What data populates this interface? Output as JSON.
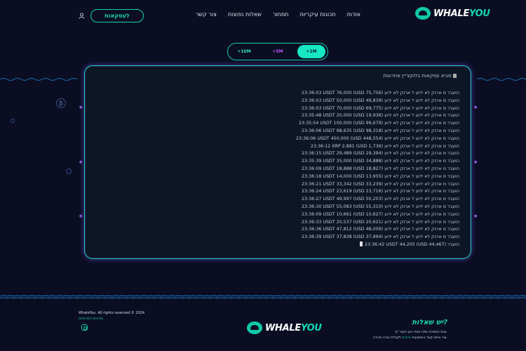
{
  "brand": {
    "name_part1": "WHALE",
    "name_part2": "YOU"
  },
  "nav": {
    "items": [
      "אודות",
      "תכונות עיקריות",
      "תמחור",
      "שאלות נפוצות",
      "צור קשר"
    ],
    "cta_label": "לעסקאות"
  },
  "filters": {
    "options": [
      "+10M",
      "+5M",
      "+1M"
    ],
    "selected": "+1M"
  },
  "feed": {
    "title": "מביא עסקאות בלוקצ'יין אחרונות",
    "rows": [
      "23:36:03 USDT 76,000 (USD 75,756) הועבר מ ארנק לא ידוע ל ארנק לא ידוע",
      "23:36:03 USDT 50,000 (USD 49,839) הועבר מ ארנק לא ידוע ל ארנק לא ידוע",
      "23:36:03 USDT 70,000 (USD 69,775) הועבר מ ארנק לא ידוע ל ארנק לא ידוע",
      "23:35:48 USDT 20,000 (USD 19,936) הועבר מ ארנק לא ידוע ל ארנק לא ידוע",
      "23:35:54 USDT 100,000 (USD 99,679) הועבר מ ארנק לא ידוע ל ארנק לא ידוע",
      "23:36:06 USDT 98,635 (USD 98,318) הועבר מ ארנק לא ידוע ל ארנק לא ידוע",
      "23:36:06 USDT 450,000 (USD 448,554) הועבר מ ארנק לא ידוע ל ארנק לא ידוע",
      "23:36:12 XRP 2,891 (USD 1,736) הועבר מ ארנק לא ידוע ל ארנק לא ידוע",
      "23:36:15 USDT 29,489 (USD 29,394) הועבר מ ארנק לא ידוע ל ארנק לא ידוע",
      "23:35:39 USDT 35,000 (USD 34,888) הועבר מ ארנק לא ידוע ל ארנק לא ידוע",
      "23:36:09 USDT 18,888 (USD 18,827) הועבר מ ארנק לא ידוע ל ארנק לא ידוע",
      "23:36:18 USDT 14,000 (USD 13,955) הועבר מ ארנק לא ידוע ל ארנק לא ידוע",
      "23:36:21 USDT 33,342 (USD 33,239) הועבר מ ארנק לא ידוע ל ארנק לא ידוע",
      "23:36:24 USDT 23,619 (USD 23,716) הועבר מ ארנק לא ידוע ל ארנק לא ידוע",
      "23:36:27 USDT 49,997 (USD 50,203) הועבר מ ארנק לא ידוע ל ארנק לא ידוע",
      "23:36:30 USDT 55,083 (USD 55,310) הועבר מ ארנק לא ידוע ל ארנק לא ידוע",
      "23:36:09 USDT 10,661 (USD 10,627) הועבר מ ארנק לא ידוע ל ארנק לא ידוע",
      "23:36:33 USDT 20,537 (USD 20,621) הועבר מ ארנק לא ידוע ל ארנק לא ידוע",
      "23:36:36 USDT 47,812 (USD 48,009) הועבר מ ארנק לא ידוע ל ארנק לא ידוע",
      "23:36:39 USDT 37,838 (USD 37,994) הועבר מ ארנק לא ידוע ל ארנק לא ידוע",
      "23:36:42 USDT 44,205 (USD 44,467) הועבר"
    ]
  },
  "footer": {
    "copyright": "WhaleYou. All rights reserved © 2024",
    "privacy": "מדיניות הפרטיות",
    "question_title": "יש שאלות?",
    "question_line1": "צוות התמיכה שלנו תמיד כאן לעזור לך.",
    "question_line2_pre": "צור איתנו קשר באמצעות",
    "question_line2_link": "טלגרם",
    "question_line2_post": "לקבלת עזרה מהירה."
  },
  "colors": {
    "accent": "#17d3b2",
    "purple": "#8e5bd9",
    "background": "#0b0e22"
  },
  "icons": [
    "user-icon",
    "instagram-icon",
    "bitcoin-icon",
    "whale-logo-icon"
  ]
}
